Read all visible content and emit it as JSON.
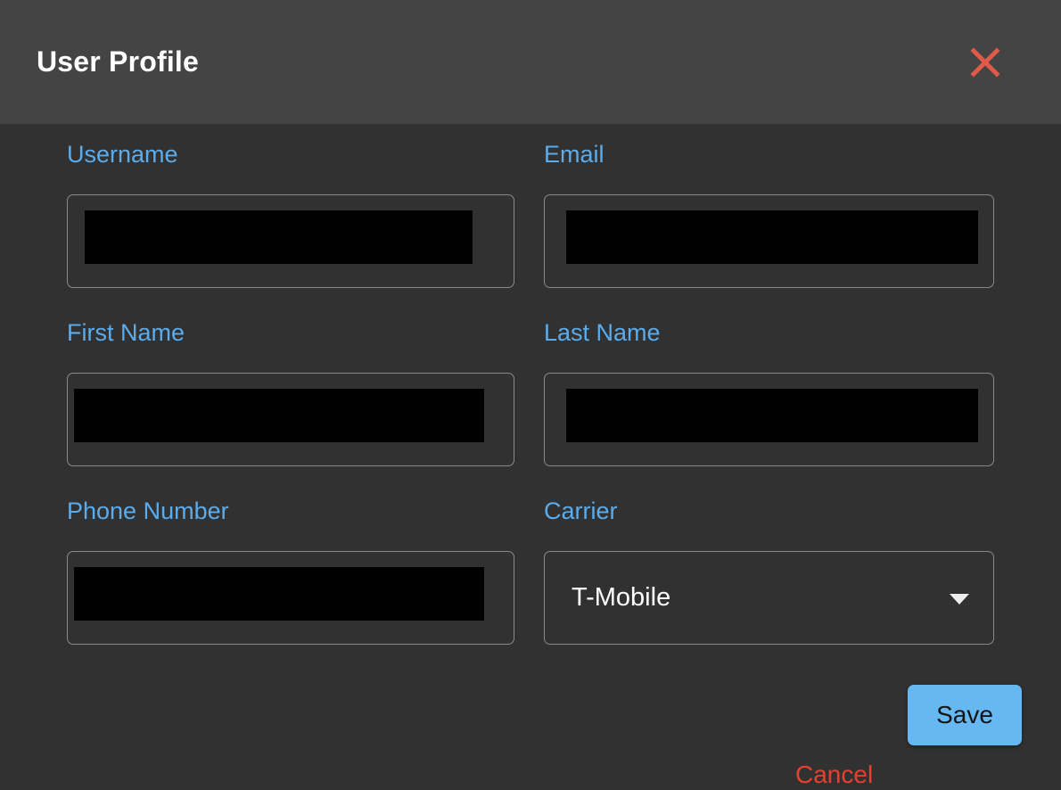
{
  "dialog": {
    "title": "User Profile",
    "close_icon": "close-x-icon",
    "colors": {
      "header_bg": "#444444",
      "body_bg": "#313131",
      "label": "#5BACEC",
      "close_x": "#E05A4A",
      "cancel": "#E8402E",
      "save_bg": "#65B8F2",
      "save_text": "#141414",
      "field_border": "#8A8A8A",
      "redaction": "#000000"
    }
  },
  "form": {
    "fields": [
      {
        "name": "username",
        "label": "Username",
        "type": "text",
        "value": "",
        "redacted": true
      },
      {
        "name": "email",
        "label": "Email",
        "type": "text",
        "value": "",
        "redacted": true
      },
      {
        "name": "first_name",
        "label": "First Name",
        "type": "text",
        "value": "",
        "redacted": true
      },
      {
        "name": "last_name",
        "label": "Last Name",
        "type": "text",
        "value": "",
        "redacted": true
      },
      {
        "name": "phone_number",
        "label": "Phone Number",
        "type": "text",
        "value": "",
        "redacted": true
      },
      {
        "name": "carrier",
        "label": "Carrier",
        "type": "select",
        "value": "T-Mobile",
        "redacted": false
      }
    ]
  },
  "actions": {
    "cancel_label": "Cancel",
    "save_label": "Save"
  }
}
